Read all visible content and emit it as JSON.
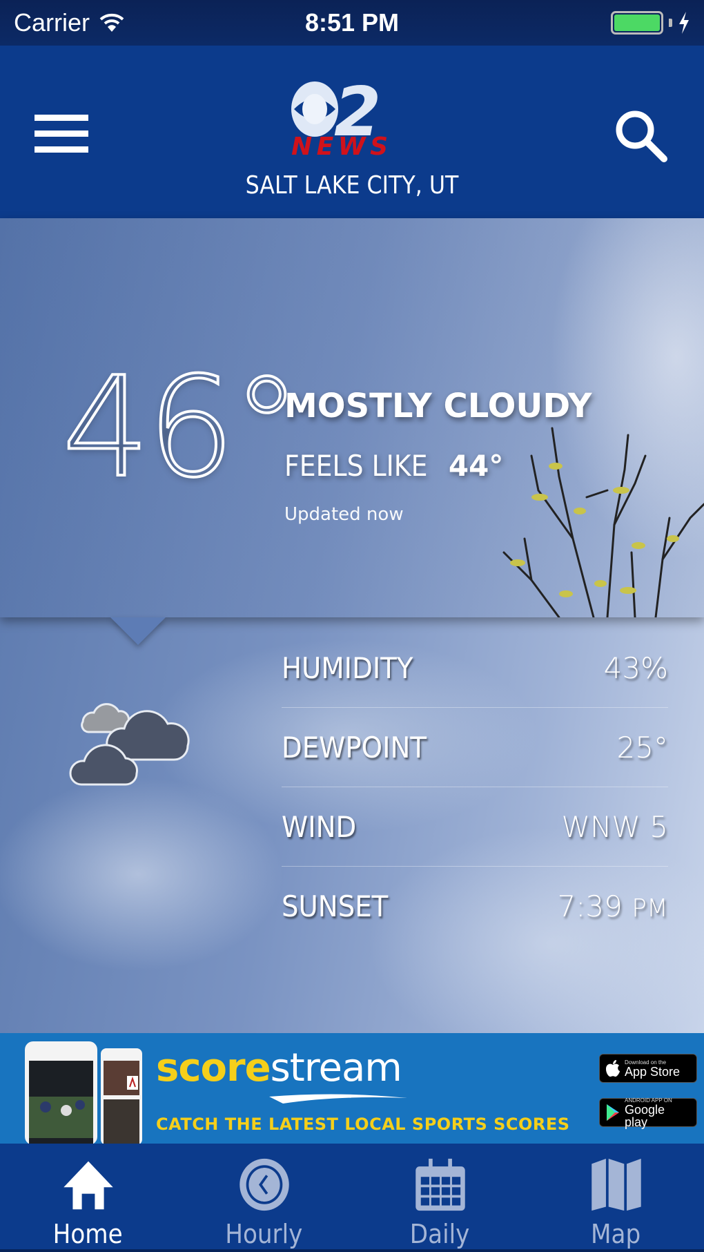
{
  "status_bar": {
    "carrier": "Carrier",
    "time": "8:51 PM",
    "battery_level": 1.0,
    "charging": true
  },
  "header": {
    "logo_number": "2",
    "logo_text": "NEWS",
    "location": "SALT LAKE CITY, UT",
    "menu_icon": "hamburger-menu-icon",
    "search_icon": "search-icon"
  },
  "current": {
    "temperature": "46°",
    "condition": "MOSTLY CLOUDY",
    "feels_like_label": "FEELS LIKE",
    "feels_like_value": "44°",
    "updated": "Updated now",
    "icon": "mostly-cloudy-icon"
  },
  "details": [
    {
      "label": "HUMIDITY",
      "value": "43%",
      "unit": ""
    },
    {
      "label": "DEWPOINT",
      "value": "25°",
      "unit": ""
    },
    {
      "label": "WIND",
      "value": "WNW 5",
      "unit": ""
    },
    {
      "label": "SUNSET",
      "value": "7:39",
      "unit": "PM"
    }
  ],
  "ad": {
    "brand_part1": "score",
    "brand_part2": "stream",
    "tagline": "CATCH THE LATEST LOCAL SPORTS SCORES",
    "app_store_small": "Download on the",
    "app_store_big": "App Store",
    "google_play_small": "ANDROID APP ON",
    "google_play_big": "Google play",
    "colors": {
      "background": "#1874bf",
      "accent": "#f5cf1a"
    }
  },
  "tabs": [
    {
      "label": "Home",
      "icon": "home-icon",
      "active": true
    },
    {
      "label": "Hourly",
      "icon": "clock-icon",
      "active": false
    },
    {
      "label": "Daily",
      "icon": "calendar-icon",
      "active": false
    },
    {
      "label": "Map",
      "icon": "map-icon",
      "active": false
    }
  ],
  "colors": {
    "header_bg": "#0c3b8c",
    "tab_active": "#ffffff",
    "tab_inactive": "#a4b5d6",
    "logo_red": "#d0121b"
  }
}
